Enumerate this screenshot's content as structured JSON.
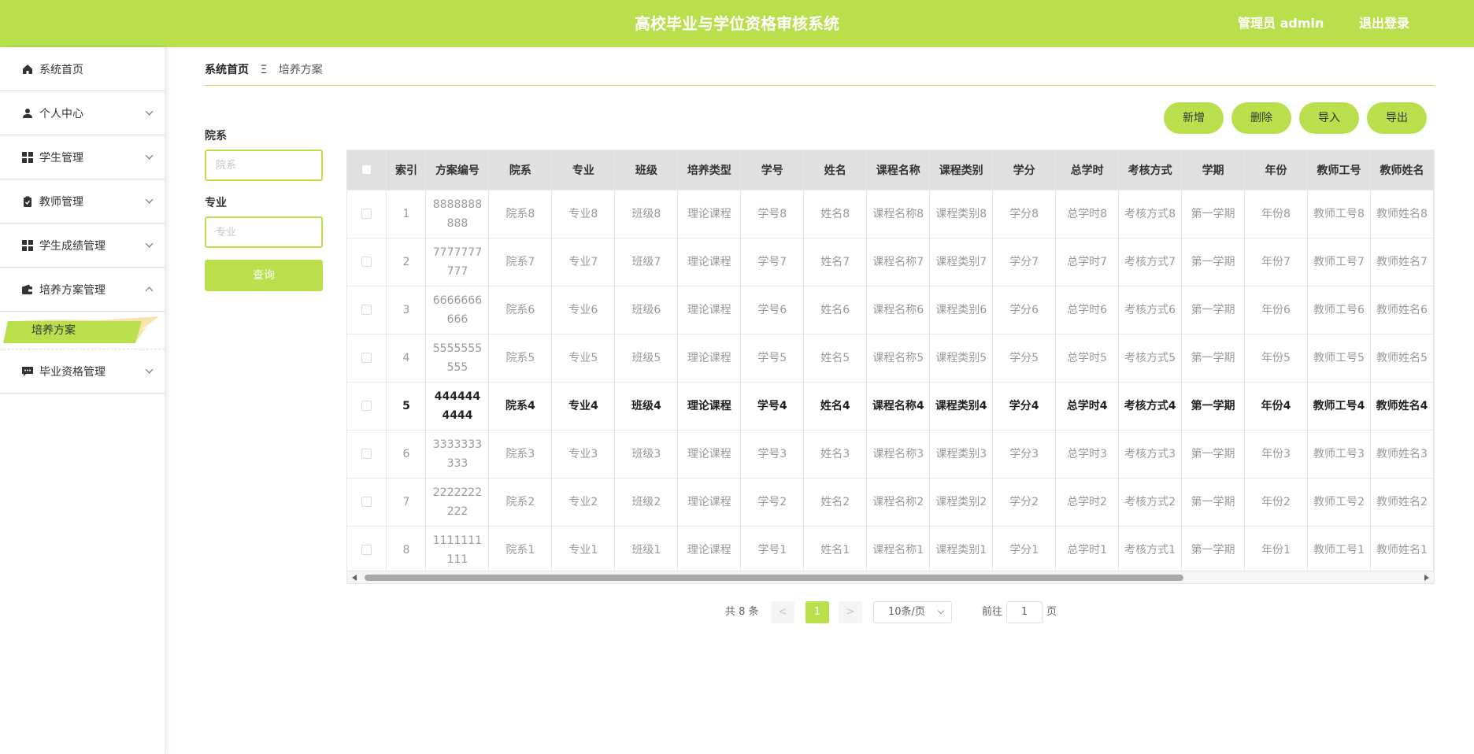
{
  "header": {
    "title": "高校毕业与学位资格审核系统",
    "user": "管理员 admin",
    "logout": "退出登录"
  },
  "sidebar": {
    "items": [
      {
        "label": "系统首页",
        "icon": "home-icon",
        "has_chevron": false
      },
      {
        "label": "个人中心",
        "icon": "user-icon",
        "has_chevron": true
      },
      {
        "label": "学生管理",
        "icon": "grid-icon",
        "has_chevron": true
      },
      {
        "label": "教师管理",
        "icon": "clipboard-icon",
        "has_chevron": true
      },
      {
        "label": "学生成绩管理",
        "icon": "grid-icon",
        "has_chevron": true
      },
      {
        "label": "培养方案管理",
        "icon": "wallet-icon",
        "has_chevron": true,
        "expanded": true
      },
      {
        "label": "毕业资格管理",
        "icon": "chat-icon",
        "has_chevron": true
      }
    ],
    "submenu_active": "培养方案",
    "accent": "#b9e04c"
  },
  "breadcrumb": {
    "home": "系统首页",
    "separator": "Ξ",
    "current": "培养方案"
  },
  "filters": {
    "dept_label": "院系",
    "dept_placeholder": "院系",
    "major_label": "专业",
    "major_placeholder": "专业",
    "query_button": "查询"
  },
  "actions": {
    "add": "新增",
    "delete": "删除",
    "import": "导入",
    "export": "导出"
  },
  "table": {
    "columns": [
      "索引",
      "方案编号",
      "院系",
      "专业",
      "班级",
      "培养类型",
      "学号",
      "姓名",
      "课程名称",
      "课程类别",
      "学分",
      "总学时",
      "考核方式",
      "学期",
      "年份",
      "教师工号",
      "教师姓名"
    ],
    "rows": [
      [
        "1",
        "8888888888",
        "院系8",
        "专业8",
        "班级8",
        "理论课程",
        "学号8",
        "姓名8",
        "课程名称8",
        "课程类别8",
        "学分8",
        "总学时8",
        "考核方式8",
        "第一学期",
        "年份8",
        "教师工号8",
        "教师姓名8"
      ],
      [
        "2",
        "7777777777",
        "院系7",
        "专业7",
        "班级7",
        "理论课程",
        "学号7",
        "姓名7",
        "课程名称7",
        "课程类别7",
        "学分7",
        "总学时7",
        "考核方式7",
        "第一学期",
        "年份7",
        "教师工号7",
        "教师姓名7"
      ],
      [
        "3",
        "6666666666",
        "院系6",
        "专业6",
        "班级6",
        "理论课程",
        "学号6",
        "姓名6",
        "课程名称6",
        "课程类别6",
        "学分6",
        "总学时6",
        "考核方式6",
        "第一学期",
        "年份6",
        "教师工号6",
        "教师姓名6"
      ],
      [
        "4",
        "5555555555",
        "院系5",
        "专业5",
        "班级5",
        "理论课程",
        "学号5",
        "姓名5",
        "课程名称5",
        "课程类别5",
        "学分5",
        "总学时5",
        "考核方式5",
        "第一学期",
        "年份5",
        "教师工号5",
        "教师姓名5"
      ],
      [
        "5",
        "4444444444",
        "院系4",
        "专业4",
        "班级4",
        "理论课程",
        "学号4",
        "姓名4",
        "课程名称4",
        "课程类别4",
        "学分4",
        "总学时4",
        "考核方式4",
        "第一学期",
        "年份4",
        "教师工号4",
        "教师姓名4"
      ],
      [
        "6",
        "3333333333",
        "院系3",
        "专业3",
        "班级3",
        "理论课程",
        "学号3",
        "姓名3",
        "课程名称3",
        "课程类别3",
        "学分3",
        "总学时3",
        "考核方式3",
        "第一学期",
        "年份3",
        "教师工号3",
        "教师姓名3"
      ],
      [
        "7",
        "2222222222",
        "院系2",
        "专业2",
        "班级2",
        "理论课程",
        "学号2",
        "姓名2",
        "课程名称2",
        "课程类别2",
        "学分2",
        "总学时2",
        "考核方式2",
        "第一学期",
        "年份2",
        "教师工号2",
        "教师姓名2"
      ],
      [
        "8",
        "1111111111",
        "院系1",
        "专业1",
        "班级1",
        "理论课程",
        "学号1",
        "姓名1",
        "课程名称1",
        "课程类别1",
        "学分1",
        "总学时1",
        "考核方式1",
        "第一学期",
        "年份1",
        "教师工号1",
        "教师姓名1"
      ]
    ],
    "highlighted_row_index": 4
  },
  "pagination": {
    "total": "共 8 条",
    "prev": "<",
    "current_page": "1",
    "next": ">",
    "page_size": "10条/页",
    "goto_label": "前往",
    "goto_value": "1",
    "page_label": "页"
  }
}
